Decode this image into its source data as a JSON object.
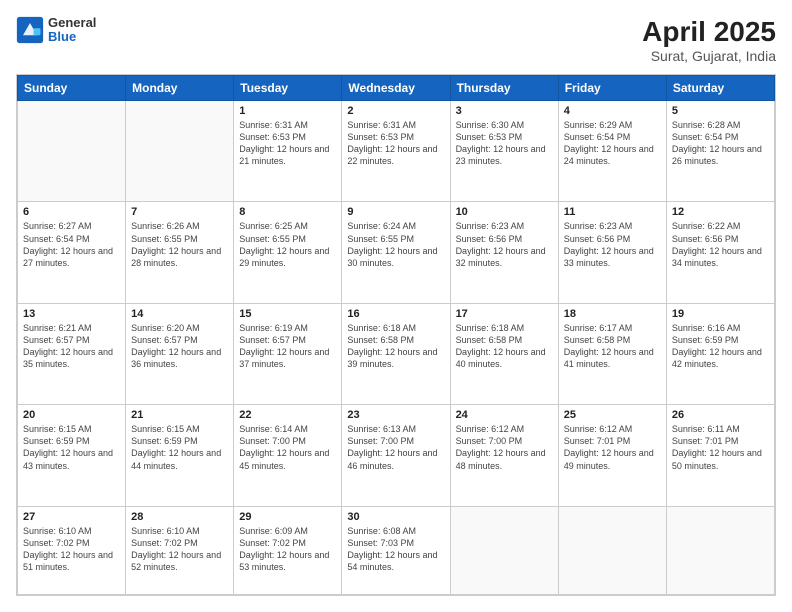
{
  "logo": {
    "general": "General",
    "blue": "Blue"
  },
  "title": "April 2025",
  "subtitle": "Surat, Gujarat, India",
  "days_of_week": [
    "Sunday",
    "Monday",
    "Tuesday",
    "Wednesday",
    "Thursday",
    "Friday",
    "Saturday"
  ],
  "weeks": [
    [
      {
        "day": "",
        "info": ""
      },
      {
        "day": "",
        "info": ""
      },
      {
        "day": "1",
        "info": "Sunrise: 6:31 AM\nSunset: 6:53 PM\nDaylight: 12 hours and 21 minutes."
      },
      {
        "day": "2",
        "info": "Sunrise: 6:31 AM\nSunset: 6:53 PM\nDaylight: 12 hours and 22 minutes."
      },
      {
        "day": "3",
        "info": "Sunrise: 6:30 AM\nSunset: 6:53 PM\nDaylight: 12 hours and 23 minutes."
      },
      {
        "day": "4",
        "info": "Sunrise: 6:29 AM\nSunset: 6:54 PM\nDaylight: 12 hours and 24 minutes."
      },
      {
        "day": "5",
        "info": "Sunrise: 6:28 AM\nSunset: 6:54 PM\nDaylight: 12 hours and 26 minutes."
      }
    ],
    [
      {
        "day": "6",
        "info": "Sunrise: 6:27 AM\nSunset: 6:54 PM\nDaylight: 12 hours and 27 minutes."
      },
      {
        "day": "7",
        "info": "Sunrise: 6:26 AM\nSunset: 6:55 PM\nDaylight: 12 hours and 28 minutes."
      },
      {
        "day": "8",
        "info": "Sunrise: 6:25 AM\nSunset: 6:55 PM\nDaylight: 12 hours and 29 minutes."
      },
      {
        "day": "9",
        "info": "Sunrise: 6:24 AM\nSunset: 6:55 PM\nDaylight: 12 hours and 30 minutes."
      },
      {
        "day": "10",
        "info": "Sunrise: 6:23 AM\nSunset: 6:56 PM\nDaylight: 12 hours and 32 minutes."
      },
      {
        "day": "11",
        "info": "Sunrise: 6:23 AM\nSunset: 6:56 PM\nDaylight: 12 hours and 33 minutes."
      },
      {
        "day": "12",
        "info": "Sunrise: 6:22 AM\nSunset: 6:56 PM\nDaylight: 12 hours and 34 minutes."
      }
    ],
    [
      {
        "day": "13",
        "info": "Sunrise: 6:21 AM\nSunset: 6:57 PM\nDaylight: 12 hours and 35 minutes."
      },
      {
        "day": "14",
        "info": "Sunrise: 6:20 AM\nSunset: 6:57 PM\nDaylight: 12 hours and 36 minutes."
      },
      {
        "day": "15",
        "info": "Sunrise: 6:19 AM\nSunset: 6:57 PM\nDaylight: 12 hours and 37 minutes."
      },
      {
        "day": "16",
        "info": "Sunrise: 6:18 AM\nSunset: 6:58 PM\nDaylight: 12 hours and 39 minutes."
      },
      {
        "day": "17",
        "info": "Sunrise: 6:18 AM\nSunset: 6:58 PM\nDaylight: 12 hours and 40 minutes."
      },
      {
        "day": "18",
        "info": "Sunrise: 6:17 AM\nSunset: 6:58 PM\nDaylight: 12 hours and 41 minutes."
      },
      {
        "day": "19",
        "info": "Sunrise: 6:16 AM\nSunset: 6:59 PM\nDaylight: 12 hours and 42 minutes."
      }
    ],
    [
      {
        "day": "20",
        "info": "Sunrise: 6:15 AM\nSunset: 6:59 PM\nDaylight: 12 hours and 43 minutes."
      },
      {
        "day": "21",
        "info": "Sunrise: 6:15 AM\nSunset: 6:59 PM\nDaylight: 12 hours and 44 minutes."
      },
      {
        "day": "22",
        "info": "Sunrise: 6:14 AM\nSunset: 7:00 PM\nDaylight: 12 hours and 45 minutes."
      },
      {
        "day": "23",
        "info": "Sunrise: 6:13 AM\nSunset: 7:00 PM\nDaylight: 12 hours and 46 minutes."
      },
      {
        "day": "24",
        "info": "Sunrise: 6:12 AM\nSunset: 7:00 PM\nDaylight: 12 hours and 48 minutes."
      },
      {
        "day": "25",
        "info": "Sunrise: 6:12 AM\nSunset: 7:01 PM\nDaylight: 12 hours and 49 minutes."
      },
      {
        "day": "26",
        "info": "Sunrise: 6:11 AM\nSunset: 7:01 PM\nDaylight: 12 hours and 50 minutes."
      }
    ],
    [
      {
        "day": "27",
        "info": "Sunrise: 6:10 AM\nSunset: 7:02 PM\nDaylight: 12 hours and 51 minutes."
      },
      {
        "day": "28",
        "info": "Sunrise: 6:10 AM\nSunset: 7:02 PM\nDaylight: 12 hours and 52 minutes."
      },
      {
        "day": "29",
        "info": "Sunrise: 6:09 AM\nSunset: 7:02 PM\nDaylight: 12 hours and 53 minutes."
      },
      {
        "day": "30",
        "info": "Sunrise: 6:08 AM\nSunset: 7:03 PM\nDaylight: 12 hours and 54 minutes."
      },
      {
        "day": "",
        "info": ""
      },
      {
        "day": "",
        "info": ""
      },
      {
        "day": "",
        "info": ""
      }
    ]
  ]
}
